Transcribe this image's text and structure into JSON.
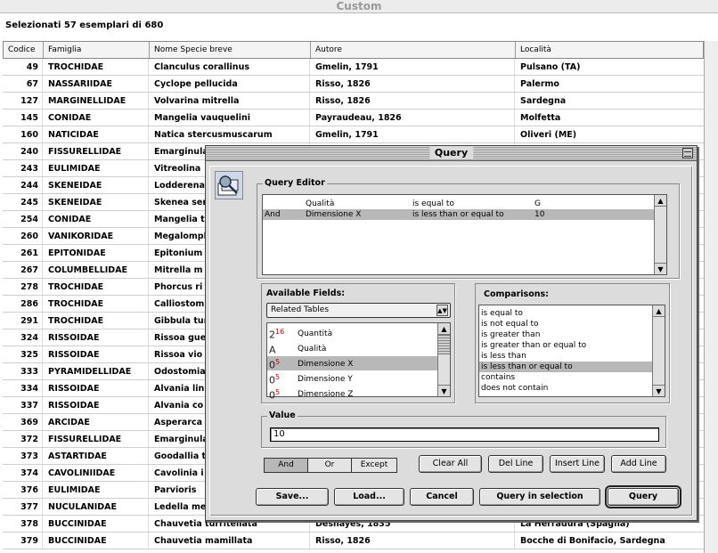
{
  "window": {
    "title": "Custom"
  },
  "selection_info": "Selezionati 57 esemplari di 680",
  "table": {
    "columns": [
      "Codice",
      "Famiglia",
      "Nome Specie breve",
      "Autore",
      "Località"
    ],
    "rows": [
      [
        "49",
        "TROCHIDAE",
        "Clanculus corallinus",
        "Gmelin, 1791",
        "Pulsano (TA)"
      ],
      [
        "67",
        "NASSARIIDAE",
        "Cyclope pellucida",
        "Risso, 1826",
        "Palermo"
      ],
      [
        "127",
        "MARGINELLIDAE",
        "Volvarina mitrella",
        "Risso, 1826",
        "Sardegna"
      ],
      [
        "145",
        "CONIDAE",
        "Mangelia vauquelini",
        "Payraudeau, 1826",
        "Molfetta"
      ],
      [
        "160",
        "NATICIDAE",
        "Natica stercusmuscarum",
        "Gmelin, 1791",
        "Oliveri (ME)"
      ],
      [
        "240",
        "FISSURELLIDAE",
        "Emarginula",
        "",
        ""
      ],
      [
        "243",
        "EULIMIDAE",
        "Vitreolina",
        "",
        ""
      ],
      [
        "244",
        "SKENEIDAE",
        "Lodderena",
        "",
        ""
      ],
      [
        "245",
        "SKENEIDAE",
        "Skenea ser",
        "",
        ""
      ],
      [
        "254",
        "CONIDAE",
        "Mangelia t",
        "",
        ""
      ],
      [
        "260",
        "VANIKORIDAE",
        "Megalomph",
        "",
        ""
      ],
      [
        "261",
        "EPITONIDAE",
        "Epitonium",
        "",
        ""
      ],
      [
        "267",
        "COLUMBELLIDAE",
        "Mitrella m",
        "",
        ""
      ],
      [
        "278",
        "TROCHIDAE",
        "Phorcus ri",
        "",
        ""
      ],
      [
        "286",
        "TROCHIDAE",
        "Calliostom",
        "",
        ""
      ],
      [
        "291",
        "TROCHIDAE",
        "Gibbula tur",
        "",
        ""
      ],
      [
        "324",
        "RISSOIDAE",
        "Rissoa gue",
        "",
        ""
      ],
      [
        "325",
        "RISSOIDAE",
        "Rissoa vio",
        "",
        ""
      ],
      [
        "333",
        "PYRAMIDELLIDAE",
        "Odostomia",
        "",
        ""
      ],
      [
        "334",
        "RISSOIDAE",
        "Alvania lin",
        "",
        ""
      ],
      [
        "337",
        "RISSOIDAE",
        "Alvania co",
        "",
        ""
      ],
      [
        "369",
        "ARCIDAE",
        "Asperarca",
        "",
        ""
      ],
      [
        "372",
        "FISSURELLIDAE",
        "Emarginula",
        "",
        ""
      ],
      [
        "373",
        "ASTARTIDAE",
        "Goodallia t",
        "",
        ""
      ],
      [
        "374",
        "CAVOLINIIDAE",
        "Cavolinia i",
        "",
        ""
      ],
      [
        "376",
        "EULIMIDAE",
        "Parvioris",
        "",
        ""
      ],
      [
        "377",
        "NUCULANIDAE",
        "Ledella me",
        "",
        ""
      ],
      [
        "378",
        "BUCCINIDAE",
        "Chauvetia turriteliata",
        "Desnayes, 1835",
        "La Herradura (Spagna)"
      ],
      [
        "379",
        "BUCCINIDAE",
        "Chauvetia mamillata",
        "Risso, 1826",
        "Bocche di Bonifacio, Sardegna"
      ]
    ]
  },
  "query": {
    "title": "Query",
    "editor_label": "Query Editor",
    "editor_lines": [
      {
        "conj": "",
        "field": "Qualità",
        "op": "is equal to",
        "value": "G",
        "selected": false
      },
      {
        "conj": "And",
        "field": "Dimensione X",
        "op": "is less than or equal to",
        "value": "10",
        "selected": true
      }
    ],
    "fields_label": "Available Fields:",
    "table_popup": "Related Tables",
    "fields": [
      {
        "icon": "2",
        "sup": "16",
        "name": "Quantità",
        "selected": false
      },
      {
        "icon": "A",
        "sup": "",
        "name": "Qualità",
        "selected": false
      },
      {
        "icon": "0",
        "sup": "5",
        "name": "Dimensione X",
        "selected": true
      },
      {
        "icon": "0",
        "sup": "5",
        "name": "Dimensione Y",
        "selected": false
      },
      {
        "icon": "0",
        "sup": "5",
        "name": "Dimensione Z",
        "selected": false
      }
    ],
    "comparisons_label": "Comparisons:",
    "comparisons": [
      {
        "label": "is equal to",
        "selected": false
      },
      {
        "label": "is not equal to",
        "selected": false
      },
      {
        "label": "is greater than",
        "selected": false
      },
      {
        "label": "is greater than or equal to",
        "selected": false
      },
      {
        "label": "is less than",
        "selected": false
      },
      {
        "label": "is less than or equal to",
        "selected": true
      },
      {
        "label": "contains",
        "selected": false
      },
      {
        "label": "does not contain",
        "selected": false
      }
    ],
    "value_label": "Value",
    "value": "10",
    "conj_buttons": {
      "and": "And",
      "or": "Or",
      "except": "Except"
    },
    "line_buttons": {
      "clear": "Clear All",
      "del": "Del Line",
      "insert": "Insert Line",
      "add": "Add Line"
    },
    "footer": {
      "save": "Save...",
      "load": "Load...",
      "cancel": "Cancel",
      "in_selection": "Query in selection",
      "query": "Query"
    }
  }
}
